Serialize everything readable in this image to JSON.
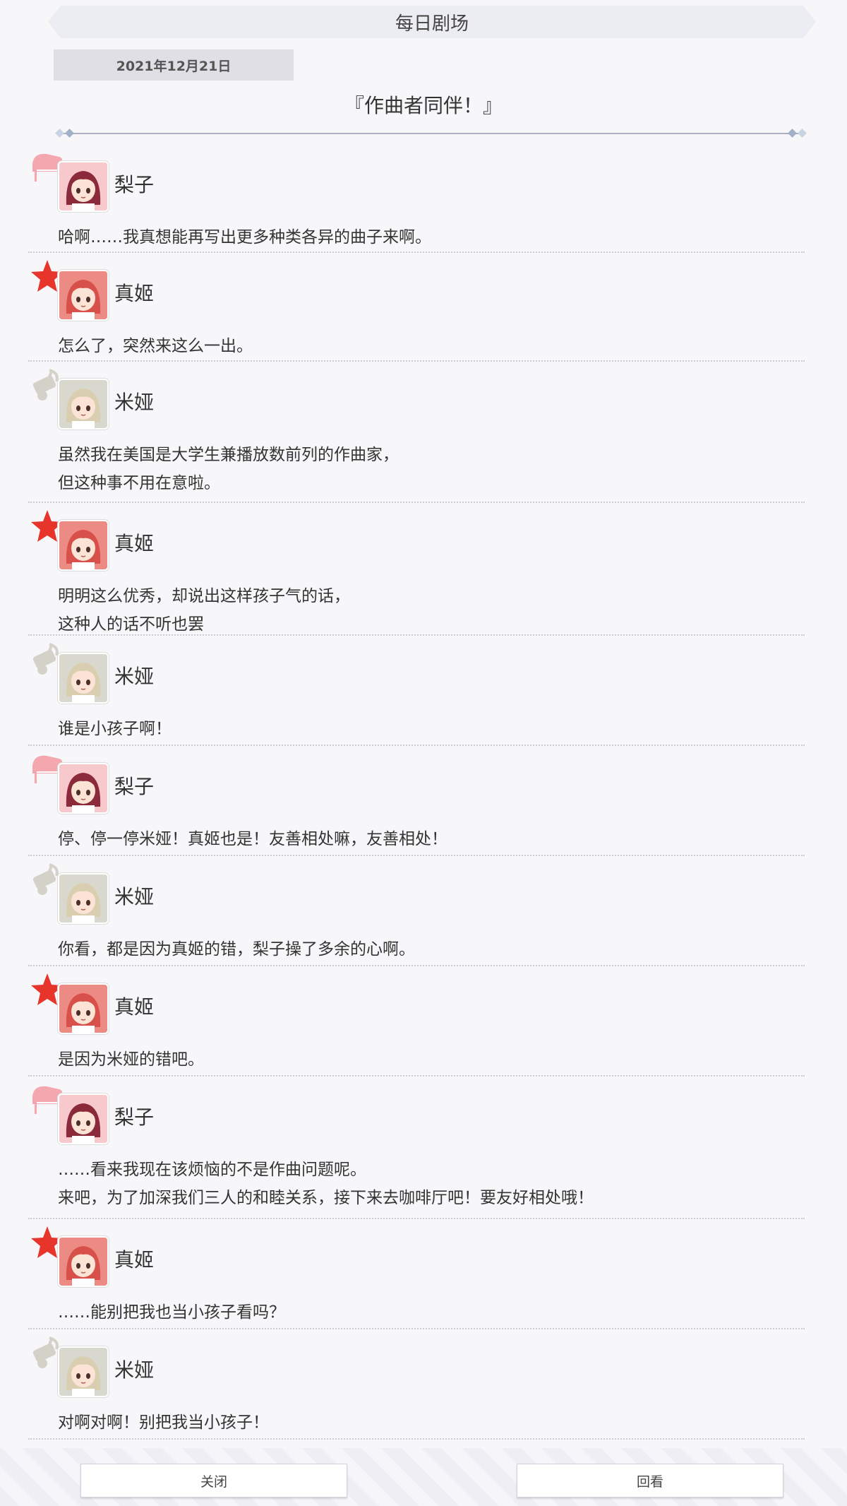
{
  "header": {
    "title": "每日剧场"
  },
  "date": "2021年12月21日",
  "theater_title": "『作曲者同伴！』",
  "characters": {
    "riko": {
      "name": "梨子",
      "badge_icon": "piano-icon",
      "color": "#f4a7ae"
    },
    "maki": {
      "name": "真姬",
      "badge_icon": "star-icon",
      "color": "#e8352c"
    },
    "mia": {
      "name": "米娅",
      "badge_icon": "music-note-icon",
      "color": "#d4d2c8"
    }
  },
  "dialogue": [
    {
      "speaker": "梨子",
      "lines": [
        "哈啊……我真想能再写出更多种类各异的曲子来啊。"
      ]
    },
    {
      "speaker": "真姬",
      "lines": [
        "怎么了，突然来这么一出。"
      ]
    },
    {
      "speaker": "米娅",
      "lines": [
        "虽然我在美国是大学生兼播放数前列的作曲家，",
        "但这种事不用在意啦。"
      ]
    },
    {
      "speaker": "真姬",
      "lines": [
        "明明这么优秀，却说出这样孩子气的话，",
        "这种人的话不听也罢"
      ]
    },
    {
      "speaker": "米娅",
      "lines": [
        "谁是小孩子啊！"
      ]
    },
    {
      "speaker": "梨子",
      "lines": [
        "停、停一停米娅！真姬也是！友善相处嘛，友善相处！"
      ]
    },
    {
      "speaker": "米娅",
      "lines": [
        "你看，都是因为真姬的错，梨子操了多余的心啊。"
      ]
    },
    {
      "speaker": "真姬",
      "lines": [
        "是因为米娅的错吧。"
      ]
    },
    {
      "speaker": "梨子",
      "lines": [
        "……看来我现在该烦恼的不是作曲问题呢。",
        "来吧，为了加深我们三人的和睦关系，接下来去咖啡厅吧！要友好相处哦！"
      ]
    },
    {
      "speaker": "真姬",
      "lines": [
        "……能别把我也当小孩子看吗？"
      ]
    },
    {
      "speaker": "米娅",
      "lines": [
        "对啊对啊！别把我当小孩子！"
      ]
    }
  ],
  "footer": {
    "close_label": "关闭",
    "review_label": "回看"
  }
}
